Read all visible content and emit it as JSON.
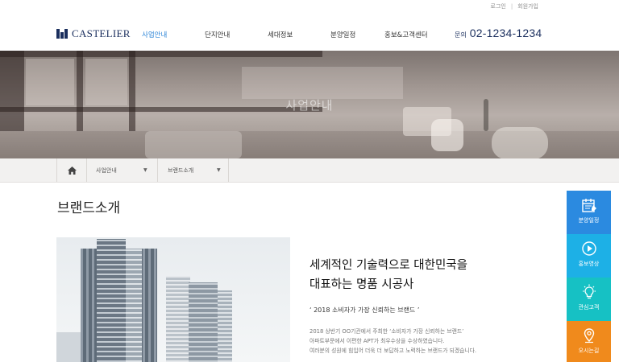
{
  "util": {
    "login": "로그인",
    "separator": "|",
    "join": "회원가입"
  },
  "brand": {
    "logo_text": "CASTELIER"
  },
  "nav": {
    "items": [
      {
        "label": "사업안내",
        "active": true
      },
      {
        "label": "단지안내",
        "active": false
      },
      {
        "label": "세대정보",
        "active": false
      },
      {
        "label": "분양일정",
        "active": false
      },
      {
        "label": "홍보&고객센터",
        "active": false
      }
    ],
    "phone_label": "문의",
    "phone_number": "02-1234-1234"
  },
  "hero": {
    "title": "사업안내"
  },
  "breadcrumb": {
    "level1": "사업안내",
    "level2": "브랜드소개"
  },
  "content": {
    "title": "브랜드소개",
    "headline_line1": "세계적인 기술력으로 대한민국을",
    "headline_line2": "대표하는 명품 시공사",
    "slogan": "‘ 2018 소비자가 가장 신뢰하는 브랜드 ’",
    "desc_line1": "2018 상반기 OO기관에서 주최한 ‘소비자가 가장 신뢰하는 브랜드’",
    "desc_line2": "아파트부문에서 이편한 APT가 최우수상을 수상하였습니다.",
    "desc_line3": "여러분의 성원에 힘입어 더욱 더 보답하고 노력하는 브랜드가 되겠습니다."
  },
  "quick_menu": [
    {
      "label": "분양일정",
      "icon": "calendar-icon",
      "color": "#2b8ae0"
    },
    {
      "label": "홍보영상",
      "icon": "play-icon",
      "color": "#1db0e6"
    },
    {
      "label": "관심고객",
      "icon": "lightbulb-icon",
      "color": "#16c1c4"
    },
    {
      "label": "오시는길",
      "icon": "map-pin-icon",
      "color": "#f08a1c"
    }
  ],
  "colors": {
    "accent": "#2e86d8",
    "brand_navy": "#1b2f5e"
  }
}
